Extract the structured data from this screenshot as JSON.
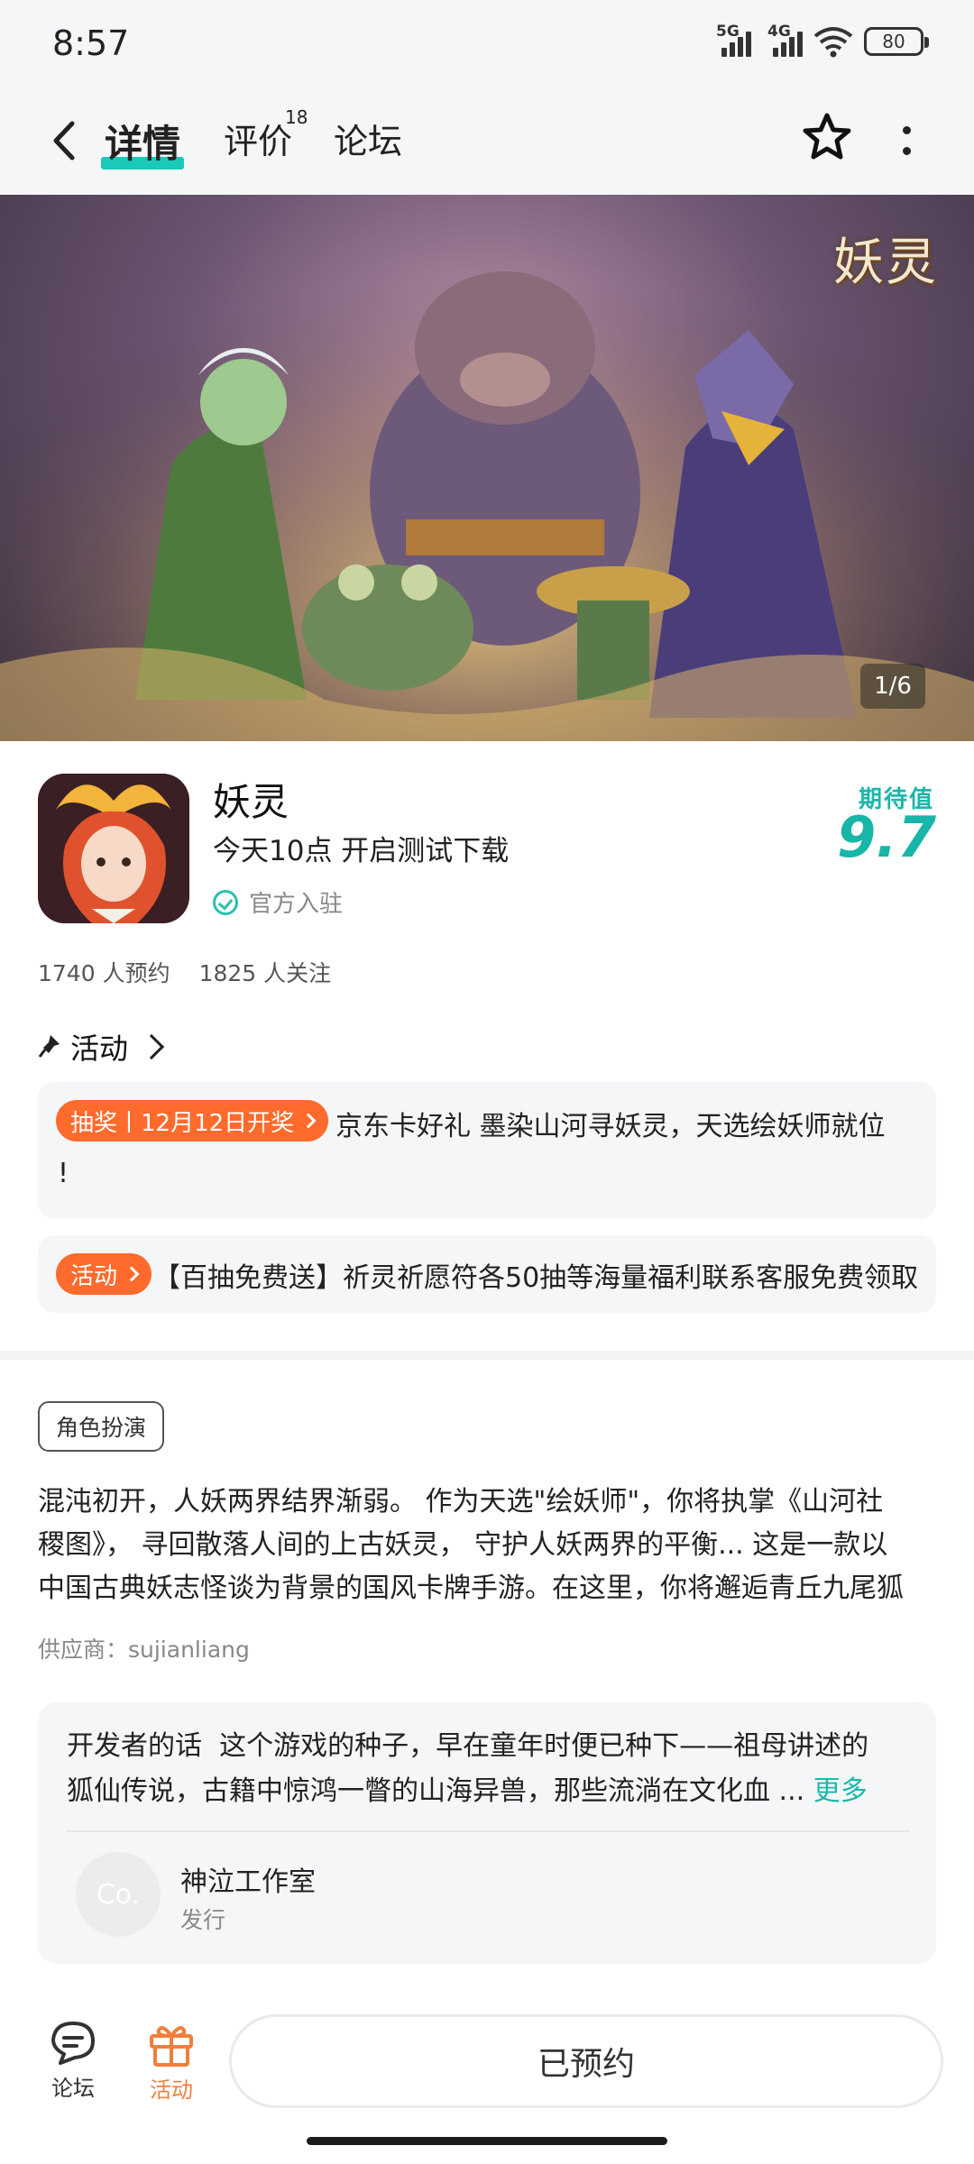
{
  "status": {
    "time": "8:57",
    "net1": "5G",
    "net2": "4G",
    "battery": "80"
  },
  "header": {
    "tabs": [
      {
        "label": "详情",
        "active": true
      },
      {
        "label": "评价",
        "badge": "18"
      },
      {
        "label": "论坛"
      }
    ],
    "icons": [
      "back-icon",
      "star-icon",
      "more-icon"
    ]
  },
  "banner": {
    "logo_text": "妖灵",
    "counter": "1/6"
  },
  "app": {
    "name": "妖灵",
    "subtitle": "今天10点 开启测试下载",
    "official": "官方入驻",
    "expect_label": "期待值",
    "expect_value": "9.7"
  },
  "stats": {
    "reservations": "1740 人预约",
    "followers": "1825 人关注"
  },
  "activity": {
    "title": "活动",
    "items": [
      {
        "tag": "抽奖丨12月12日开奖",
        "text_line1": "京东卡好礼 墨染山河寻妖灵，天选绘妖师就位",
        "text_line2": "!"
      },
      {
        "tag": "活动",
        "text": "【百抽免费送】祈灵祈愿符各50抽等海量福利联系客服免费领取"
      }
    ]
  },
  "genre": "角色扮演",
  "description": {
    "line1": "混沌初开，人妖两界结界渐弱。 作为天选\"绘妖师\"，你将执掌《山河社",
    "line2": "稷图》， 寻回散落人间的上古妖灵， 守护人妖两界的平衡... 这是一款以",
    "line3": "中国古典妖志怪谈为背景的国风卡牌手游。在这里，你将邂逅青丘九尾狐"
  },
  "supplier": "供应商：sujianliang",
  "developer": {
    "label": "开发者的话",
    "line1": "这个游戏的种子，早在童年时便已种下——祖母讲述的",
    "line2": "狐仙传说，古籍中惊鸿一瞥的山海异兽，那些流淌在文化血 ...",
    "more": "更多",
    "avatar_text": "Co.",
    "studio_name": "神泣工作室",
    "studio_role": "发行"
  },
  "bottom": {
    "forum_label": "论坛",
    "activity_label": "活动",
    "reserve_button": "已预约"
  },
  "colors": {
    "accent": "#1ac9b9",
    "orange": "#ff6b2c",
    "activity_icon": "#f07f3c"
  }
}
